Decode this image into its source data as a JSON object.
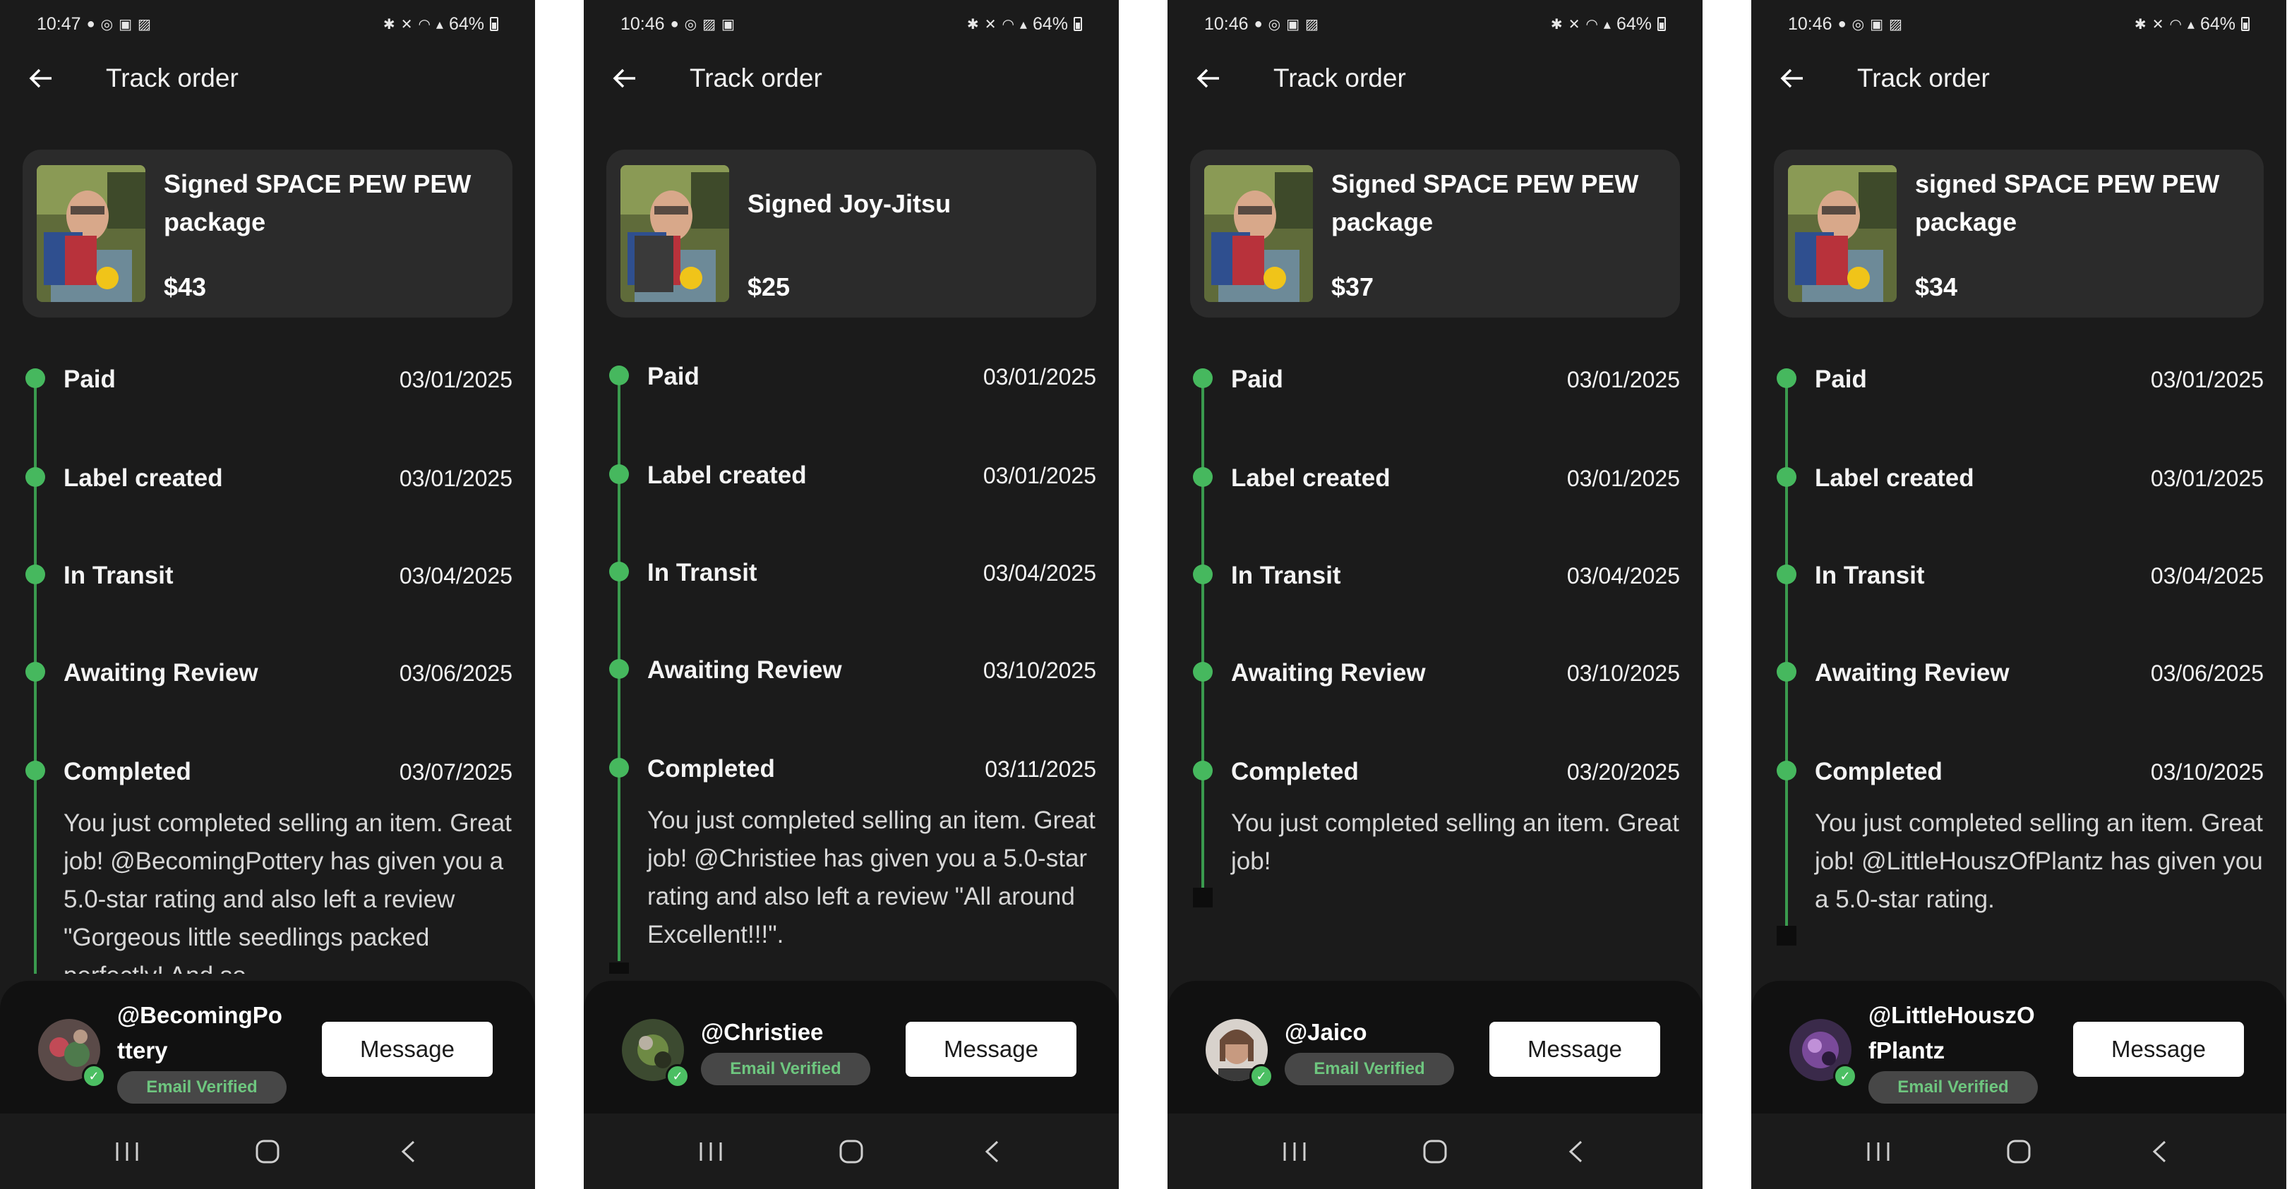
{
  "colors": {
    "background": "#1b1b1b",
    "card": "#2b2b2b",
    "accent": "#46b85e",
    "verified_text": "#6ec67f"
  },
  "icons": [
    "back-arrow-icon",
    "chat-icon",
    "instagram-icon",
    "app-icon",
    "image-icon",
    "bluetooth-icon",
    "mute-icon",
    "wifi-icon",
    "signal-icon",
    "battery-icon",
    "verified-check-icon",
    "recents-icon",
    "home-icon",
    "back-nav-icon"
  ],
  "screens": [
    {
      "status": {
        "time": "10:47",
        "battery": "64%"
      },
      "header": {
        "title": "Track order"
      },
      "product": {
        "title": "Signed SPACE PEW PEW package",
        "price": "$43"
      },
      "steps": [
        {
          "label": "Paid",
          "date": "03/01/2025"
        },
        {
          "label": "Label created",
          "date": "03/01/2025"
        },
        {
          "label": "In Transit",
          "date": "03/04/2025"
        },
        {
          "label": "Awaiting Review",
          "date": "03/06/2025"
        },
        {
          "label": "Completed",
          "date": "03/07/2025"
        }
      ],
      "completion_message": "You just completed selling an item. Great job! @BecomingPottery has given you a 5.0-star rating and also left a review \"Gorgeous little seedlings packed perfectly! And so",
      "buyer": {
        "username": "@BecomingPo ttery",
        "badge": "Email Verified"
      },
      "message_button": "Message"
    },
    {
      "status": {
        "time": "10:46",
        "battery": "64%"
      },
      "header": {
        "title": "Track order"
      },
      "product": {
        "title": "Signed Joy-Jitsu",
        "price": "$25"
      },
      "steps": [
        {
          "label": "Paid",
          "date": "03/01/2025"
        },
        {
          "label": "Label created",
          "date": "03/01/2025"
        },
        {
          "label": "In Transit",
          "date": "03/04/2025"
        },
        {
          "label": "Awaiting Review",
          "date": "03/10/2025"
        },
        {
          "label": "Completed",
          "date": "03/11/2025"
        }
      ],
      "completion_message": "You just completed selling an item. Great job! @Christiee has given you a 5.0-star rating and also left a review \"All around Excellent!!!\".",
      "buyer": {
        "username": "@Christiee",
        "badge": "Email Verified"
      },
      "message_button": "Message"
    },
    {
      "status": {
        "time": "10:46",
        "battery": "64%"
      },
      "header": {
        "title": "Track order"
      },
      "product": {
        "title": "Signed SPACE PEW PEW package",
        "price": "$37"
      },
      "steps": [
        {
          "label": "Paid",
          "date": "03/01/2025"
        },
        {
          "label": "Label created",
          "date": "03/01/2025"
        },
        {
          "label": "In Transit",
          "date": "03/04/2025"
        },
        {
          "label": "Awaiting Review",
          "date": "03/10/2025"
        },
        {
          "label": "Completed",
          "date": "03/20/2025"
        }
      ],
      "completion_message": "You just completed selling an item. Great job!",
      "buyer": {
        "username": "@Jaico",
        "badge": "Email Verified"
      },
      "message_button": "Message"
    },
    {
      "status": {
        "time": "10:46",
        "battery": "64%"
      },
      "header": {
        "title": "Track order"
      },
      "product": {
        "title": "signed SPACE PEW PEW package",
        "price": "$34"
      },
      "steps": [
        {
          "label": "Paid",
          "date": "03/01/2025"
        },
        {
          "label": "Label created",
          "date": "03/01/2025"
        },
        {
          "label": "In Transit",
          "date": "03/04/2025"
        },
        {
          "label": "Awaiting Review",
          "date": "03/06/2025"
        },
        {
          "label": "Completed",
          "date": "03/10/2025"
        }
      ],
      "completion_message": "You just completed selling an item. Great job! @LittleHouszOfPlantz has given you a 5.0-star rating.",
      "buyer": {
        "username": "@LittleHouszO fPlantz",
        "badge": "Email Verified"
      },
      "message_button": "Message"
    }
  ]
}
